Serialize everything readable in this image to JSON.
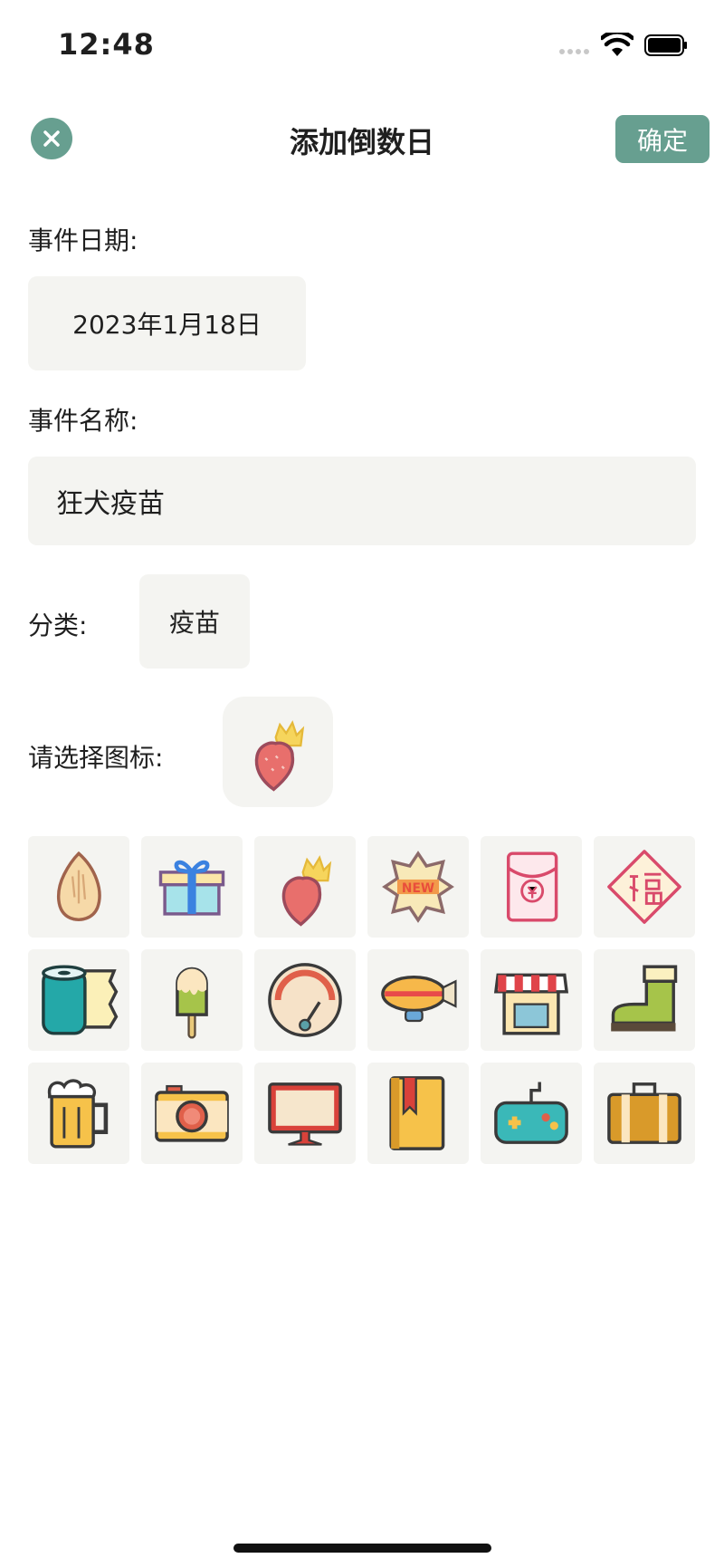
{
  "status_bar": {
    "time": "12:48"
  },
  "header": {
    "title": "添加倒数日",
    "confirm_label": "确定"
  },
  "form": {
    "date_label": "事件日期:",
    "date_value": "2023年1月18日",
    "name_label": "事件名称:",
    "name_value": "狂犬疫苗",
    "category_label": "分类:",
    "category_value": "疫苗",
    "icon_label": "请选择图标:"
  },
  "selected_icon": "strawberry-crown-icon",
  "icons": [
    "almond-icon",
    "gift-icon",
    "strawberry-crown-icon",
    "new-badge-icon",
    "red-envelope-icon",
    "fu-icon",
    "paper-towel-icon",
    "popsicle-icon",
    "gauge-icon",
    "airship-icon",
    "shop-icon",
    "boot-icon",
    "beer-icon",
    "camera-icon",
    "monitor-icon",
    "book-icon",
    "gamepad-icon",
    "briefcase-icon"
  ],
  "colors": {
    "accent": "#679f90",
    "field_bg": "#f4f4f1"
  }
}
